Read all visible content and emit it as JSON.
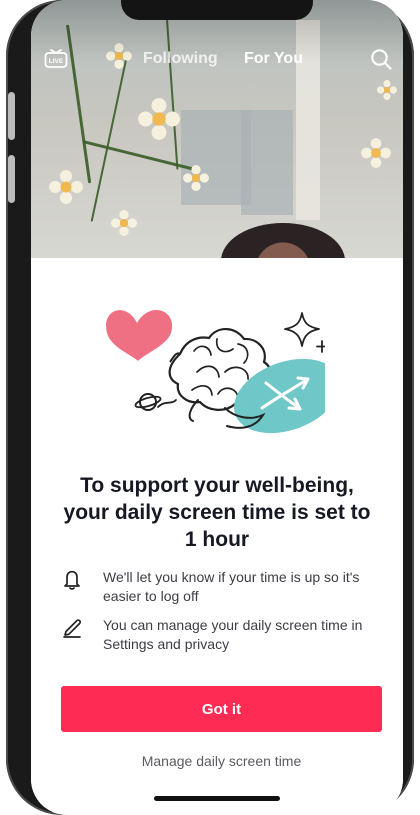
{
  "header": {
    "live_icon": "live-tv-icon",
    "tabs": [
      {
        "label": "Following"
      },
      {
        "label": "For You"
      }
    ],
    "search_icon": "search-icon"
  },
  "wellbeing_sheet": {
    "illustration": "brain-heart-clock-illustration",
    "title": "To support your well-being, your daily screen time is set to 1 hour",
    "items": [
      {
        "icon": "bell-icon",
        "text": "We'll let you know if your time is up so it's easier to log off"
      },
      {
        "icon": "pencil-icon",
        "text": "You can manage your daily screen time in Settings and privacy"
      }
    ],
    "primary_button": "Got it",
    "secondary_link": "Manage daily screen time"
  },
  "colors": {
    "accent": "#fe2c55",
    "text_primary": "#161823",
    "text_secondary": "#3c3d45",
    "illustration_heart": "#ef6f83",
    "illustration_clock": "#6fc7c8"
  }
}
